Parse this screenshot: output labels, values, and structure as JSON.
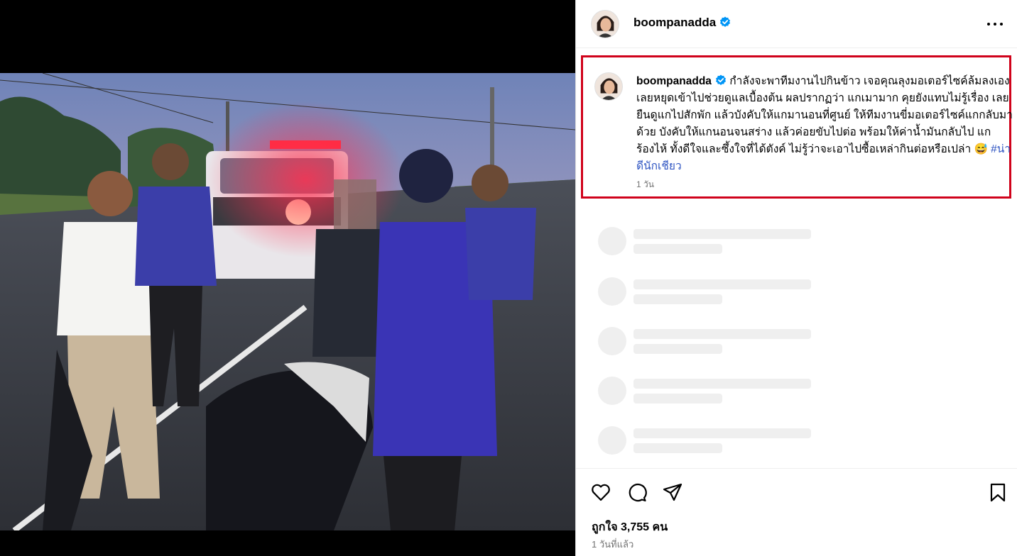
{
  "post": {
    "username": "boompanadda",
    "verified": true,
    "caption": {
      "username": "boompanadda",
      "text": "กำลังจะพาทีมงานไปกินข้าว เจอคุณลุงมอเตอร์ไซค์ล้มลงเอง เลยหยุดเข้าไปช่วยดูแลเบื้องต้น ผลปรากฏว่า แกเมามาก คุยยังแทบไม่รู้เรื่อง เลยยืนดูแกไปสักพัก แล้วบังคับให้แกมานอนที่ศูนย์ ให้ทีมงานขี่มอเตอร์ไซค์แกกลับมาด้วย บังคับให้แกนอนจนสร่าง แล้วค่อยขับไปต่อ พร้อมให้ค่าน้ำมันกลับไป แกร้องไห้ ทั้งดีใจและซึ้งใจที่ได้ตังค์ ไม่รู้ว่าจะเอาไปซื้อเหล่ากินต่อหรือเปล่า",
      "emoji": "😅",
      "hashtag": "#น่าดีนักเชียว",
      "time": "1 วัน"
    },
    "likes": "ถูกใจ 3,755 คน",
    "posted": "1 วันที่แล้ว"
  },
  "icons": {
    "more": "more-options-icon",
    "like": "heart-icon",
    "comment": "comment-icon",
    "share": "share-icon",
    "save": "bookmark-icon",
    "verified": "verified-badge-icon"
  },
  "colors": {
    "verified": "#0095f6",
    "highlight_border": "#d0021b",
    "hashtag": "#2f55c2",
    "secondary_text": "#737373",
    "skeleton": "#efefef"
  }
}
